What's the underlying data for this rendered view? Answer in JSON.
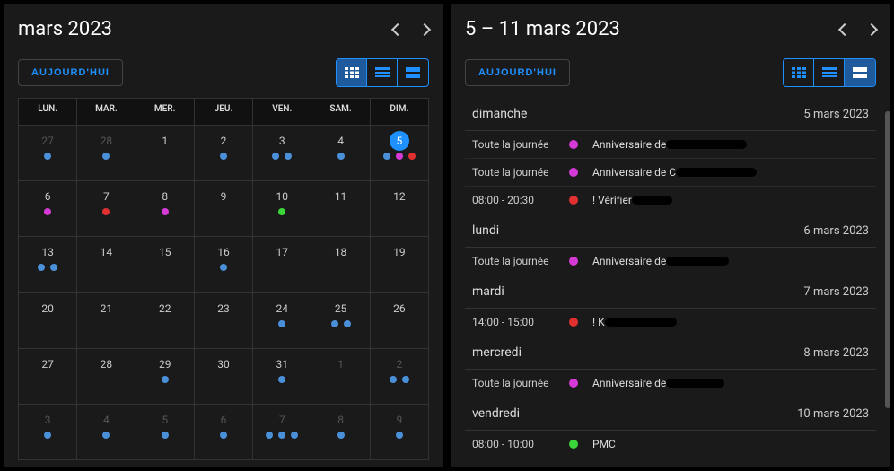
{
  "colors": {
    "blue": "#4a90d9",
    "magenta": "#d63ad6",
    "red": "#e03030",
    "green": "#3ad63a",
    "accent": "#1e90ff"
  },
  "shared": {
    "today_label": "AUJOURD'HUI",
    "view_modes": [
      "month-grid",
      "agenda-compact",
      "agenda-list"
    ]
  },
  "month_panel": {
    "title": "mars 2023",
    "weekdays": [
      "LUN.",
      "MAR.",
      "MER.",
      "JEU.",
      "VEN.",
      "SAM.",
      "DIM."
    ],
    "active_view": 0,
    "weeks": [
      [
        {
          "day": 27,
          "other": true,
          "dots": [
            "blue"
          ]
        },
        {
          "day": 28,
          "other": true,
          "dots": [
            "blue"
          ]
        },
        {
          "day": 1,
          "dots": []
        },
        {
          "day": 2,
          "dots": [
            "blue"
          ]
        },
        {
          "day": 3,
          "dots": [
            "blue",
            "blue"
          ]
        },
        {
          "day": 4,
          "dots": [
            "blue"
          ]
        },
        {
          "day": 5,
          "today": true,
          "dots": [
            "blue",
            "magenta",
            "red"
          ]
        }
      ],
      [
        {
          "day": 6,
          "dots": [
            "magenta"
          ]
        },
        {
          "day": 7,
          "dots": [
            "red"
          ]
        },
        {
          "day": 8,
          "dots": [
            "magenta"
          ]
        },
        {
          "day": 9,
          "dots": []
        },
        {
          "day": 10,
          "dots": [
            "green"
          ]
        },
        {
          "day": 11,
          "dots": []
        },
        {
          "day": 12,
          "dots": []
        }
      ],
      [
        {
          "day": 13,
          "dots": [
            "blue",
            "blue"
          ]
        },
        {
          "day": 14,
          "dots": []
        },
        {
          "day": 15,
          "dots": []
        },
        {
          "day": 16,
          "dots": [
            "blue"
          ]
        },
        {
          "day": 17,
          "dots": []
        },
        {
          "day": 18,
          "dots": []
        },
        {
          "day": 19,
          "dots": []
        }
      ],
      [
        {
          "day": 20,
          "dots": []
        },
        {
          "day": 21,
          "dots": []
        },
        {
          "day": 22,
          "dots": []
        },
        {
          "day": 23,
          "dots": []
        },
        {
          "day": 24,
          "dots": [
            "blue"
          ]
        },
        {
          "day": 25,
          "dots": [
            "blue",
            "blue"
          ]
        },
        {
          "day": 26,
          "dots": []
        }
      ],
      [
        {
          "day": 27,
          "dots": []
        },
        {
          "day": 28,
          "dots": []
        },
        {
          "day": 29,
          "dots": [
            "blue"
          ]
        },
        {
          "day": 30,
          "dots": []
        },
        {
          "day": 31,
          "dots": [
            "blue"
          ]
        },
        {
          "day": 1,
          "other": true,
          "dots": []
        },
        {
          "day": 2,
          "other": true,
          "dots": [
            "blue",
            "blue"
          ]
        }
      ],
      [
        {
          "day": 3,
          "other": true,
          "dots": [
            "blue"
          ]
        },
        {
          "day": 4,
          "other": true,
          "dots": [
            "blue"
          ]
        },
        {
          "day": 5,
          "other": true,
          "dots": [
            "blue"
          ]
        },
        {
          "day": 6,
          "other": true,
          "dots": [
            "blue"
          ]
        },
        {
          "day": 7,
          "other": true,
          "dots": [
            "blue",
            "blue",
            "blue"
          ]
        },
        {
          "day": 8,
          "other": true,
          "dots": [
            "blue"
          ]
        },
        {
          "day": 9,
          "other": true,
          "dots": [
            "blue"
          ]
        }
      ]
    ]
  },
  "agenda_panel": {
    "title": "5 – 11 mars 2023",
    "active_view": 2,
    "all_day_label": "Toute la journée",
    "days": [
      {
        "name": "dimanche",
        "date": "5 mars 2023",
        "events": [
          {
            "time": "all_day",
            "color": "magenta",
            "title": "Anniversaire de ",
            "redact": 90
          },
          {
            "time": "all_day",
            "color": "magenta",
            "title": "Anniversaire de C",
            "redact": 90
          },
          {
            "time": "08:00 - 20:30",
            "color": "red",
            "title": "! Vérifier ",
            "redact": 45
          }
        ]
      },
      {
        "name": "lundi",
        "date": "6 mars 2023",
        "events": [
          {
            "time": "all_day",
            "color": "magenta",
            "title": "Anniversaire de ",
            "redact": 70
          }
        ]
      },
      {
        "name": "mardi",
        "date": "7 mars 2023",
        "events": [
          {
            "time": "14:00 - 15:00",
            "color": "red",
            "title": "! K",
            "redact": 80
          }
        ]
      },
      {
        "name": "mercredi",
        "date": "8 mars 2023",
        "events": [
          {
            "time": "all_day",
            "color": "magenta",
            "title": "Anniversaire de ",
            "redact": 65
          }
        ]
      },
      {
        "name": "vendredi",
        "date": "10 mars 2023",
        "events": [
          {
            "time": "08:00 - 10:00",
            "color": "green",
            "title": "PMC"
          }
        ]
      }
    ]
  }
}
